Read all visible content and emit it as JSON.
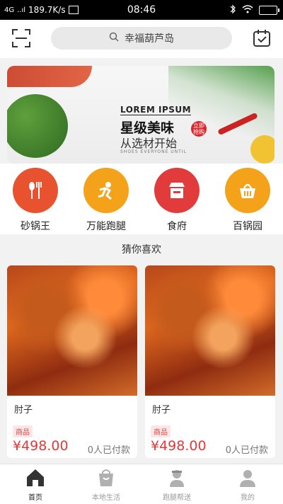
{
  "status_bar": {
    "network": "4G",
    "signal": "..ıl",
    "speed": "189.7K/s",
    "time": "08:46"
  },
  "search": {
    "placeholder": "幸福葫芦岛"
  },
  "banner": {
    "title": "LOREM IPSUM",
    "headline": "星级美味",
    "subheadline": "从选材开始",
    "tagline": "SHOES EVERYONE UNTIL",
    "stamp_text": "立即抢购"
  },
  "categories": [
    {
      "label": "砂锅王",
      "icon": "spoon-fork-icon",
      "color": "#e8522e"
    },
    {
      "label": "万能跑腿",
      "icon": "runner-icon",
      "color": "#f3a21a"
    },
    {
      "label": "食府",
      "icon": "store-icon",
      "color": "#e23b3b"
    },
    {
      "label": "百锅园",
      "icon": "basket-icon",
      "color": "#f3a21a"
    }
  ],
  "guess_section": {
    "title": "猜你喜欢"
  },
  "products": [
    {
      "name": "肘子",
      "tag": "商品",
      "price": "¥498.00",
      "sold": "0人已付款"
    },
    {
      "name": "肘子",
      "tag": "商品",
      "price": "¥498.00",
      "sold": "0人已付款"
    }
  ],
  "tabbar": [
    {
      "label": "首页",
      "icon": "home-icon",
      "active": true
    },
    {
      "label": "本地生活",
      "icon": "shopping-bag-icon",
      "active": false
    },
    {
      "label": "跑腿帮送",
      "icon": "courier-icon",
      "active": false
    },
    {
      "label": "我的",
      "icon": "user-icon",
      "active": false
    }
  ],
  "colors": {
    "accent": "#e03a3a",
    "status_bar": "#000000"
  }
}
